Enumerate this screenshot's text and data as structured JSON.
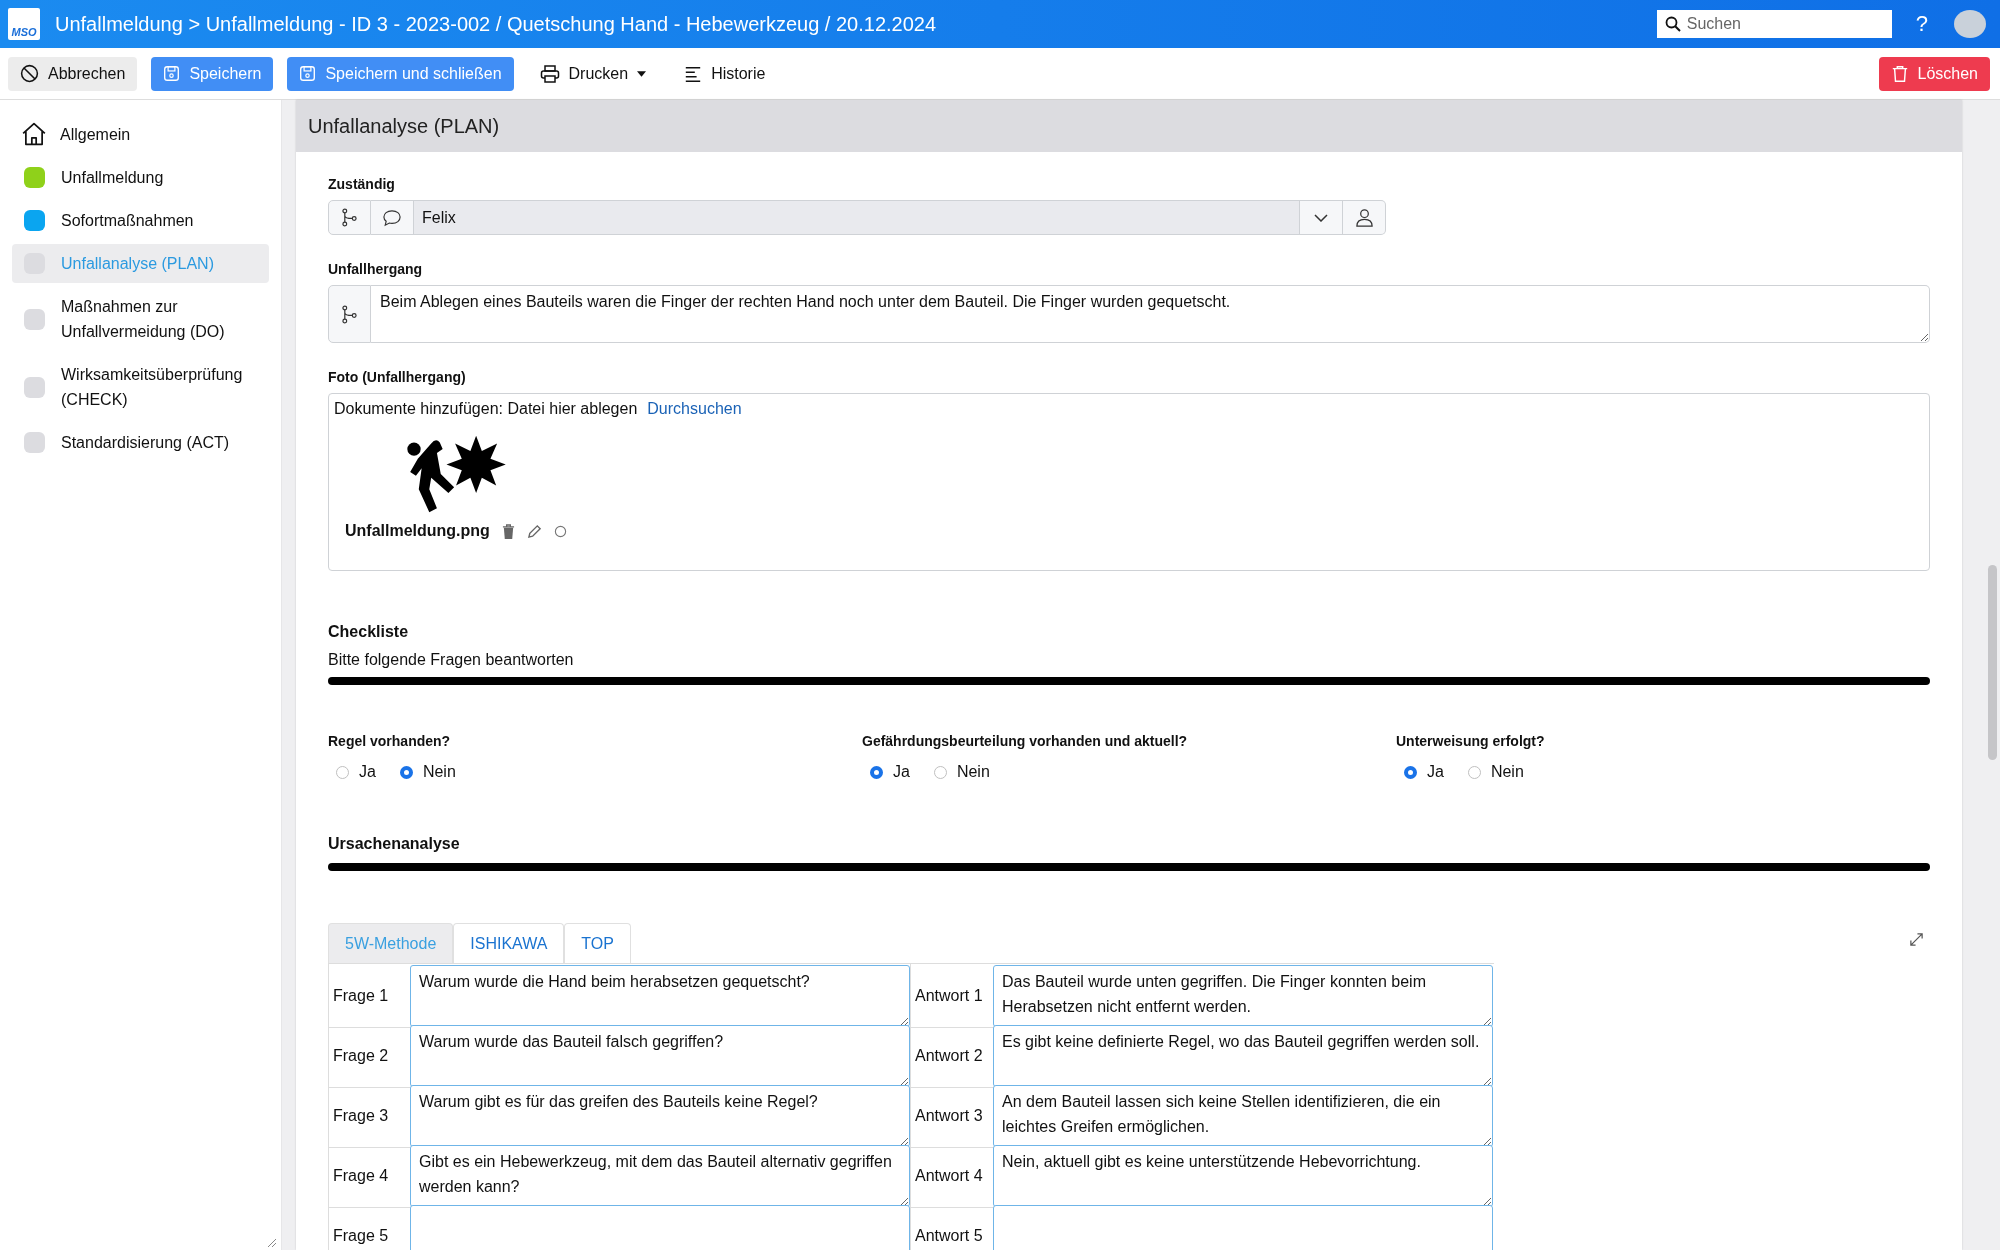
{
  "app": {
    "logo": "MSO",
    "title": "Unfallmeldung > Unfallmeldung - ID 3 - 2023-002 / Quetschung Hand - Hebewerkzeug / 20.12.2024",
    "search_placeholder": "Suchen",
    "help": "?"
  },
  "toolbar": {
    "buttons": [
      {
        "label": "Abbrechen",
        "kind": "cancel"
      },
      {
        "label": "Speichern",
        "kind": "save"
      },
      {
        "label": "Speichern und schließen",
        "kind": "save"
      },
      {
        "label": "Drucken",
        "kind": "print"
      },
      {
        "label": "Historie",
        "kind": "history"
      }
    ],
    "delete": "Löschen"
  },
  "sidebar": {
    "items": [
      {
        "label": "Allgemein",
        "kind": "home",
        "selected": false
      },
      {
        "label": "Unfallmeldung",
        "kind": "status",
        "color": "#8fd11a",
        "selected": false
      },
      {
        "label": "Sofortmaßnahmen",
        "kind": "status",
        "color": "#0aa5f0",
        "selected": false
      },
      {
        "label": "Unfallanalyse (PLAN)",
        "kind": "status",
        "color": "#dcdce0",
        "selected": true
      },
      {
        "label": "Maßnahmen zur Unfallvermeidung (DO)",
        "kind": "status",
        "color": "#dcdce0",
        "selected": false
      },
      {
        "label": "Wirksamkeitsüberprüfung (CHECK)",
        "kind": "status",
        "color": "#dcdce0",
        "selected": false
      },
      {
        "label": "Standardisierung (ACT)",
        "kind": "status",
        "color": "#dcdce0",
        "selected": false
      }
    ]
  },
  "panel": {
    "title": "Unfallanalyse (PLAN)",
    "responsible": {
      "label": "Zuständig",
      "value": "Felix"
    },
    "description": {
      "label": "Unfallhergang",
      "value": "Beim Ablegen eines Bauteils waren die Finger der rechten Hand noch unter dem Bauteil. Die Finger wurden gequetscht."
    },
    "photo": {
      "label": "Foto (Unfallhergang)",
      "prompt": "Dokumente hinzufügen: Datei hier ablegen",
      "browse": "Durchsuchen",
      "file": "Unfallmeldung.png"
    },
    "checklist": {
      "title": "Checkliste",
      "hint": "Bitte folgende Fragen beantworten",
      "questions": [
        {
          "label": "Regel vorhanden?",
          "options": [
            {
              "label": "Ja",
              "selected": false
            },
            {
              "label": "Nein",
              "selected": true
            }
          ]
        },
        {
          "label": "Gefährdungsbeurteilung vorhanden und aktuell?",
          "options": [
            {
              "label": "Ja",
              "selected": true
            },
            {
              "label": "Nein",
              "selected": false
            }
          ]
        },
        {
          "label": "Unterweisung erfolgt?",
          "options": [
            {
              "label": "Ja",
              "selected": true
            },
            {
              "label": "Nein",
              "selected": false
            }
          ]
        }
      ]
    },
    "cause_analysis": {
      "title": "Ursachenanalyse",
      "tabs": [
        {
          "label": "5W-Methode",
          "selected": true
        },
        {
          "label": "ISHIKAWA",
          "selected": false
        },
        {
          "label": "TOP",
          "selected": false
        }
      ],
      "rows": [
        {
          "question_label": "Frage 1",
          "question": "Warum wurde die Hand beim herabsetzen gequetscht?",
          "answer_label": "Antwort 1",
          "answer": "Das Bauteil wurde unten gegriffen. Die Finger konnten beim Herabsetzen nicht entfernt werden."
        },
        {
          "question_label": "Frage 2",
          "question": "Warum wurde das Bauteil falsch gegriffen?",
          "answer_label": "Antwort 2",
          "answer": "Es gibt keine definierte Regel, wo das Bauteil gegriffen werden soll."
        },
        {
          "question_label": "Frage 3",
          "question": "Warum gibt es für das greifen des Bauteils keine Regel?",
          "answer_label": "Antwort 3",
          "answer": "An dem Bauteil lassen sich keine Stellen identifizieren, die ein leichtes Greifen ermöglichen."
        },
        {
          "question_label": "Frage 4",
          "question": "Gibt es ein Hebewerkzeug, mit dem das Bauteil alternativ gegriffen werden kann?",
          "answer_label": "Antwort 4",
          "answer": "Nein, aktuell gibt es keine unterstützende Hebevorrichtung."
        },
        {
          "question_label": "Frage 5",
          "answer_label": "Antwort 5"
        }
      ]
    }
  }
}
